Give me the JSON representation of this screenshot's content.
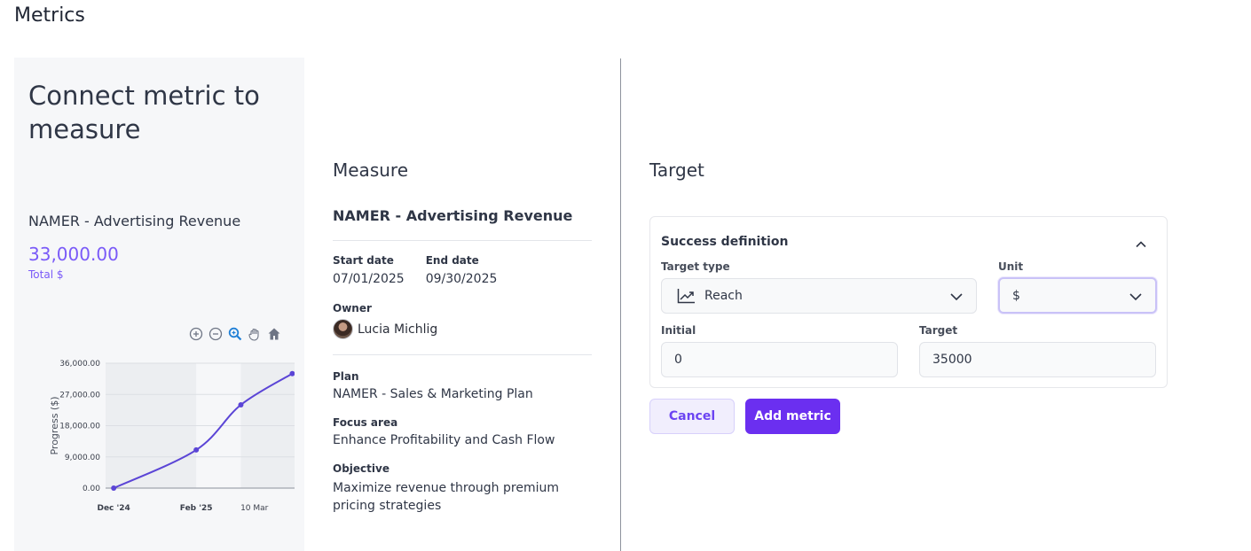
{
  "page": {
    "title": "Metrics"
  },
  "left": {
    "heading": "Connect metric to measure",
    "metric_name": "NAMER - Advertising Revenue",
    "metric_value": "33,000.00",
    "metric_unit": "Total $",
    "toolbar_icons": [
      "zoom-in-icon",
      "zoom-out-icon",
      "zoom-select-icon",
      "pan-hand-icon",
      "home-icon"
    ]
  },
  "chart_data": {
    "type": "line",
    "ylabel": "Progress ($)",
    "xlabel": "",
    "ylim": [
      0,
      36000
    ],
    "y_ticks": [
      "0.00",
      "9,000.00",
      "18,000.00",
      "27,000.00",
      "36,000.00"
    ],
    "x_ticks": [
      "Dec '24",
      "Feb '25",
      "10 Mar"
    ],
    "series": [
      {
        "points": [
          {
            "x": "2024-12-01",
            "y": 0
          },
          {
            "x": "2025-01-31",
            "y": 11000
          },
          {
            "x": "2025-03-05",
            "y": 24000
          },
          {
            "x": "2025-04-12",
            "y": 33000
          }
        ]
      }
    ],
    "color": "#5b45d6",
    "grid": true
  },
  "measure": {
    "title": "Measure",
    "name": "NAMER - Advertising Revenue",
    "start_label": "Start date",
    "start_value": "07/01/2025",
    "end_label": "End date",
    "end_value": "09/30/2025",
    "owner_label": "Owner",
    "owner_name": "Lucia Michlig",
    "plan_label": "Plan",
    "plan_value": "NAMER - Sales & Marketing Plan",
    "focus_label": "Focus area",
    "focus_value": "Enhance Profitability and Cash Flow",
    "objective_label": "Objective",
    "objective_value": "Maximize revenue through premium pricing strategies"
  },
  "target": {
    "title": "Target",
    "card_title": "Success definition",
    "target_type_label": "Target type",
    "target_type_value": "Reach",
    "unit_label": "Unit",
    "unit_value": "$",
    "initial_label": "Initial",
    "initial_value": "0",
    "target_label": "Target",
    "target_value": "35000"
  },
  "actions": {
    "cancel": "Cancel",
    "add": "Add metric"
  },
  "colors": {
    "accent": "#6b2ff0",
    "metric": "#7a5af8",
    "line": "#5b45d6"
  }
}
